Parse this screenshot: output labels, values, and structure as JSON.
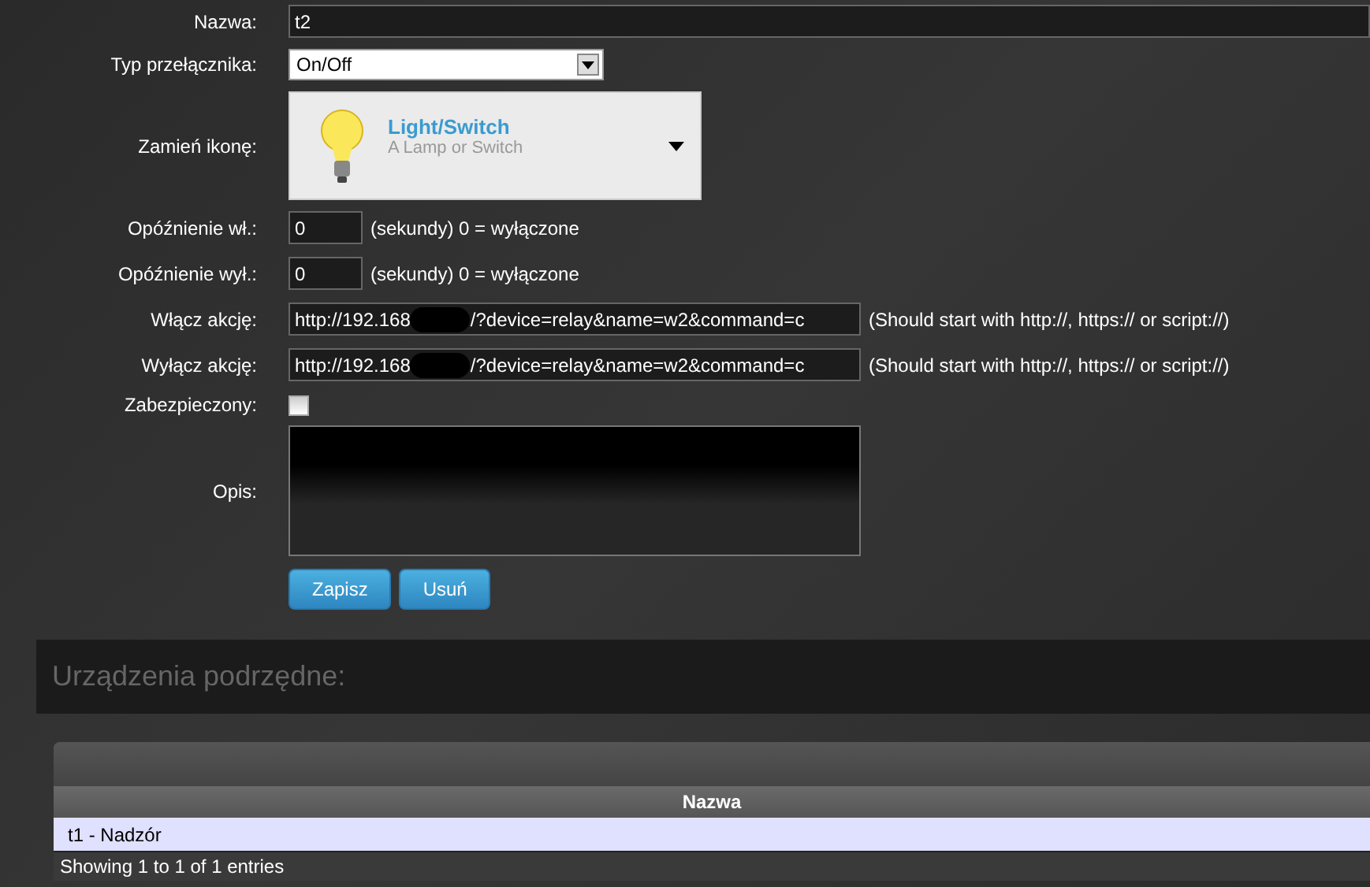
{
  "form": {
    "name": {
      "label": "Nazwa:",
      "value": "t2"
    },
    "switch_type": {
      "label": "Typ przełącznika:",
      "value": "On/Off"
    },
    "icon": {
      "label": "Zamień ikonę:",
      "title": "Light/Switch",
      "subtitle": "A Lamp or Switch"
    },
    "delays": [
      {
        "label": "Opóźnienie wł.:",
        "value": "0",
        "hint": "(sekundy) 0 = wyłączone"
      },
      {
        "label": "Opóźnienie wył.:",
        "value": "0",
        "hint": "(sekundy) 0 = wyłączone"
      }
    ],
    "actions": [
      {
        "label": "Włącz akcję:",
        "value_start": "http://192.168",
        "value_end": "/?device=relay&name=w2&command=c",
        "hint": "(Should start with http://, https:// or script://)"
      },
      {
        "label": "Wyłącz akcję:",
        "value_start": "http://192.168",
        "value_end": "/?device=relay&name=w2&command=c",
        "hint": "(Should start with http://, https:// or script://)"
      }
    ],
    "protected": {
      "label": "Zabezpieczony:",
      "checked": false
    },
    "description": {
      "label": "Opis:"
    },
    "buttons": [
      "Zapisz",
      "Usuń"
    ]
  },
  "subdevices": {
    "title": "Urządzenia podrzędne:",
    "columns": [
      "Nazwa"
    ],
    "rows": [
      [
        "t1 - Nadzór"
      ]
    ],
    "footer": "Showing 1 to 1 of 1 entries"
  }
}
